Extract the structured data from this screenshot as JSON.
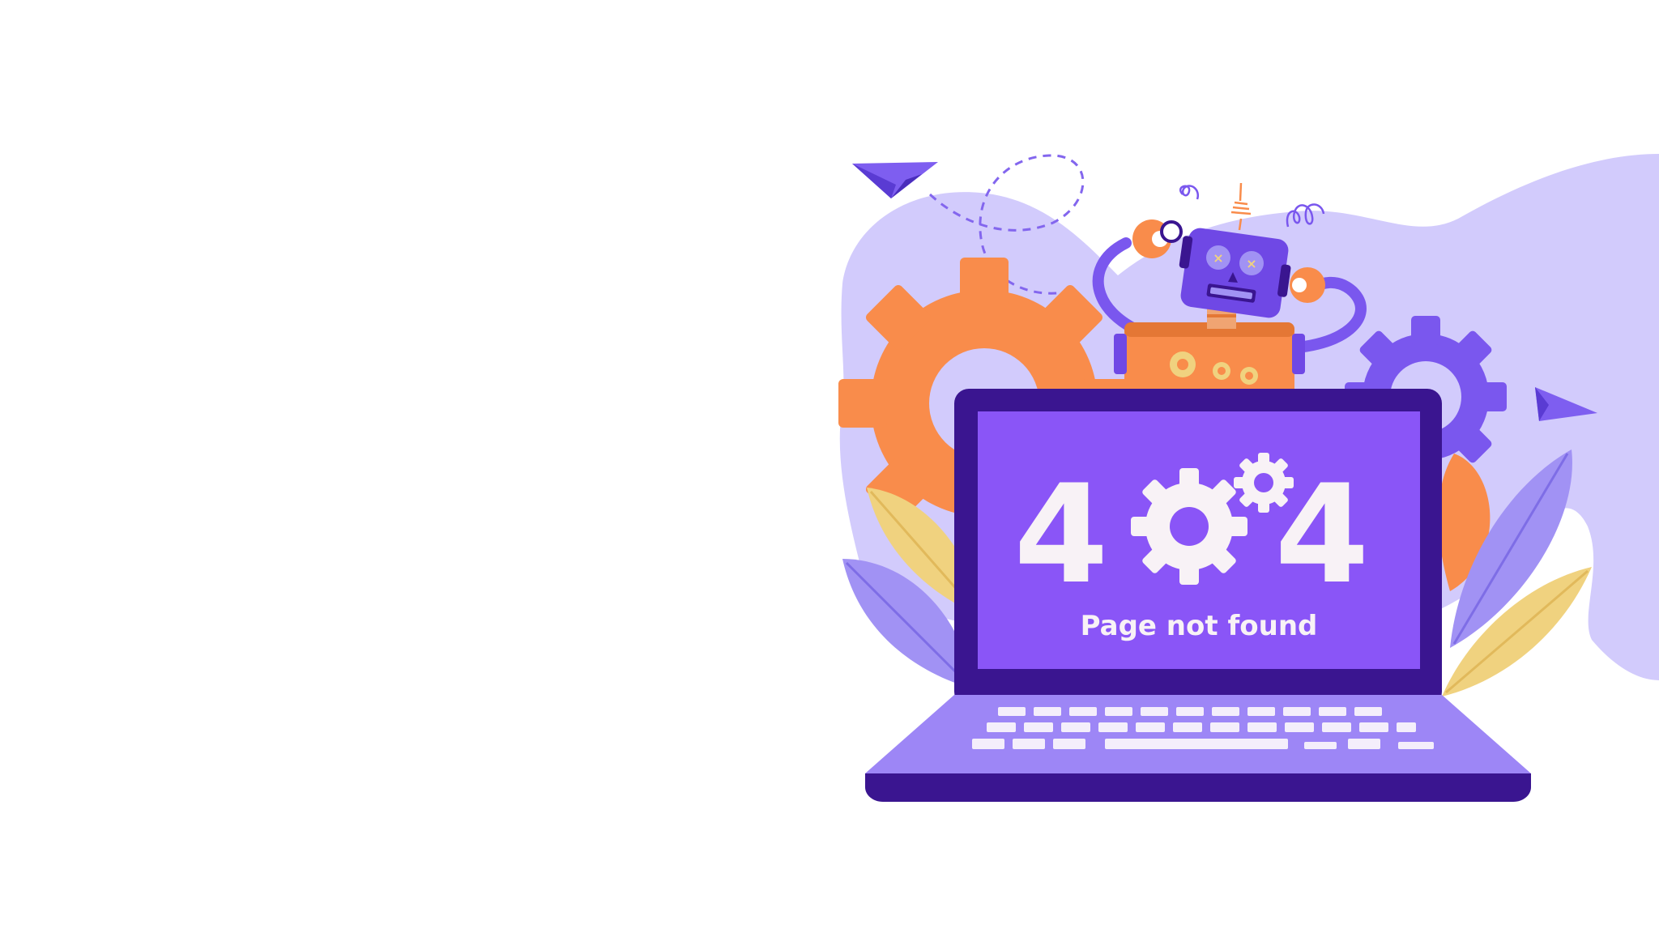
{
  "error": {
    "code_first_digit": "4",
    "code_last_digit": "4",
    "message": "Page not found"
  },
  "colors": {
    "background": "#ffffff",
    "blob": "#d2cbfc",
    "screen": "#8a55f7",
    "laptop_frame": "#3a1590",
    "keyboard_deck": "#9d86f6",
    "keys": "#f4eefb",
    "gear_orange": "#f98c4b",
    "gear_purple": "#7a57ee",
    "leaf_yellow": "#f0d27f",
    "leaf_purple": "#a192f4",
    "robot_head": "#6f48e5",
    "robot_body": "#f98c4b"
  },
  "icons": [
    "paper-plane-icon",
    "gear-icon",
    "robot-icon",
    "laptop-icon",
    "leaf-icon"
  ]
}
